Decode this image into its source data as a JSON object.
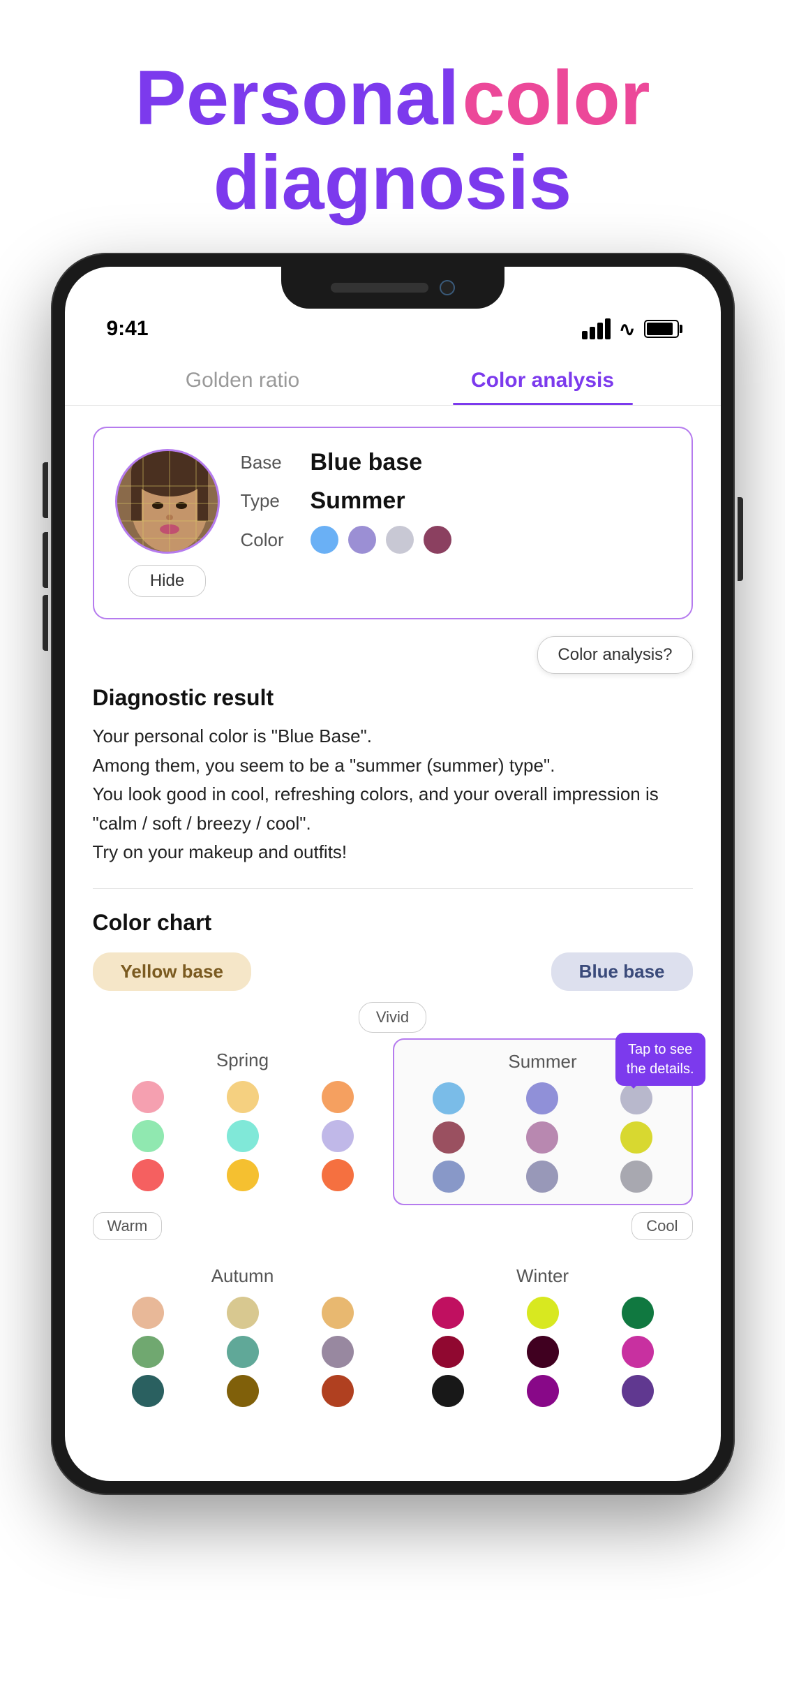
{
  "header": {
    "title_personal": "Personal",
    "title_color": "color",
    "title_diagnosis": "diagnosis"
  },
  "status_bar": {
    "time": "9:41",
    "signal": "4 bars",
    "wifi": "on",
    "battery": "full"
  },
  "tabs": [
    {
      "id": "golden-ratio",
      "label": "Golden ratio",
      "active": false
    },
    {
      "id": "color-analysis",
      "label": "Color analysis",
      "active": true
    }
  ],
  "result_card": {
    "base_label": "Base",
    "base_value": "Blue base",
    "type_label": "Type",
    "type_value": "Summer",
    "color_label": "Color",
    "colors": [
      "#6ab0f5",
      "#9b8fd4",
      "#c8c8d4",
      "#8b4060"
    ],
    "hide_button": "Hide"
  },
  "color_analysis_button": "Color analysis?",
  "diagnostic": {
    "section_title": "Diagnostic result",
    "text": "Your personal color is \"Blue Base\".\nAmong them, you seem to be a \"summer (summer) type\".\nYou look good in cool, refreshing colors, and your overall impression is \"calm / soft / breezy / cool\".\nTry on your makeup and outfits!"
  },
  "color_chart": {
    "section_title": "Color chart",
    "yellow_base_label": "Yellow base",
    "blue_base_label": "Blue base",
    "vivid_label": "Vivid",
    "warm_label": "Warm",
    "cool_label": "Cool",
    "tap_tooltip": "Tap to see\nthe details.",
    "seasons": {
      "spring": {
        "name": "Spring",
        "colors": [
          "#f5a0b0",
          "#f5d080",
          "#f5a060",
          "#90e8b0",
          "#80e8d8",
          "#c0b8e8",
          "#f56060",
          "#f5c030",
          "#f57040"
        ]
      },
      "summer": {
        "name": "Summer",
        "highlighted": true,
        "colors": [
          "#7abce8",
          "#9090d8",
          "#b8b8cc",
          "#9a5060",
          "#b888b0",
          "#d8d830",
          "#8898c8",
          "#9898b8",
          "#a8a8b0"
        ]
      },
      "autumn": {
        "name": "Autumn",
        "colors": [
          "#e8b898",
          "#d8c890",
          "#e8b870",
          "#70a870",
          "#60a898",
          "#9888a0",
          "#d85040",
          "#d8a020",
          "#e86020"
        ]
      },
      "winter": {
        "name": "Winter",
        "colors": [
          "#c01060",
          "#d8e820",
          "#107840",
          "#900830",
          "#400020",
          "#c830a0",
          "#181818",
          "#880888",
          "#603890"
        ]
      }
    }
  }
}
